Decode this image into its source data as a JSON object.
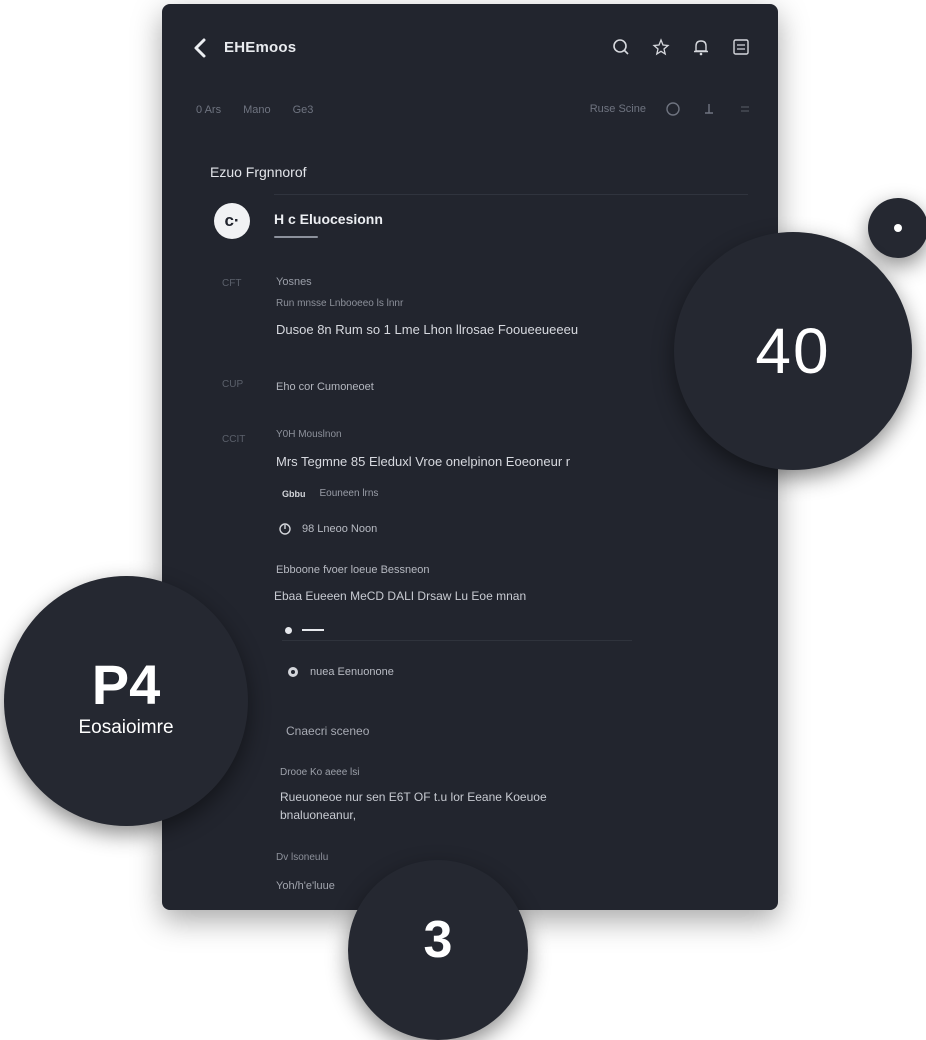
{
  "window": {
    "title": "EHEmoos",
    "toolbar_icons": [
      "search-icon",
      "star-icon",
      "bell-icon",
      "menu-icon"
    ]
  },
  "subbar": {
    "tabs": [
      "0 Ars",
      "Mano",
      "Ge3"
    ],
    "right_label": "Ruse Scine",
    "right_icons": [
      "chat-icon",
      "export-icon",
      "close-icon"
    ]
  },
  "section": {
    "title": "Ezuo Frgnnorof",
    "header_avatar": "c·",
    "header_label": "H c Eluocesionn"
  },
  "content": {
    "row1": {
      "gutter": "CFT",
      "line1": "Yosnes",
      "line2": "Run mnsse Lnbooeeo ls lnnr",
      "line3": "Dusoe 8n Rum so 1 Lme Lhon llrosae Fooueeueeeu"
    },
    "row2": {
      "gutter": "CUP",
      "line1": "Eho cor Cumoneoet"
    },
    "row3": {
      "gutter": "CCIT",
      "line1": "Y0H Mouslnon",
      "line2": "Mrs Tegmne 85 Eleduxl Vroe onelpinon Eoeoneur r",
      "chip_a": "Gbbu",
      "chip_b": "Eouneen lrns",
      "icon_line": "98 Lneoo Noon"
    },
    "row4": {
      "line1": "Ebboone fvoer loeue Bessneon",
      "line2": "Ebaa Eueeen MeCD DALI Drsaw Lu Eoe mnan"
    },
    "row5": {
      "icon_line": "nuea Eenuonone",
      "subhead": "Cnaecri sceneo",
      "label": "Drooe Ko aeee lsi",
      "line1": "Rueuoneoe nur sen E6T OF t.u lor Eeane Koeuoe",
      "line2": "bnaluoneanur,",
      "label2": "Dv lsoneulu",
      "footer": "Yoh/h'e'luue"
    }
  },
  "bubbles": {
    "count": "40",
    "page_big": "P4",
    "page_caption": "Eosaioimre",
    "step": "3"
  },
  "colors": {
    "panel_bg": "#22252e",
    "bubble_bg": "#252831",
    "text_primary": "#eceef2",
    "text_secondary": "#9a9ea8"
  }
}
